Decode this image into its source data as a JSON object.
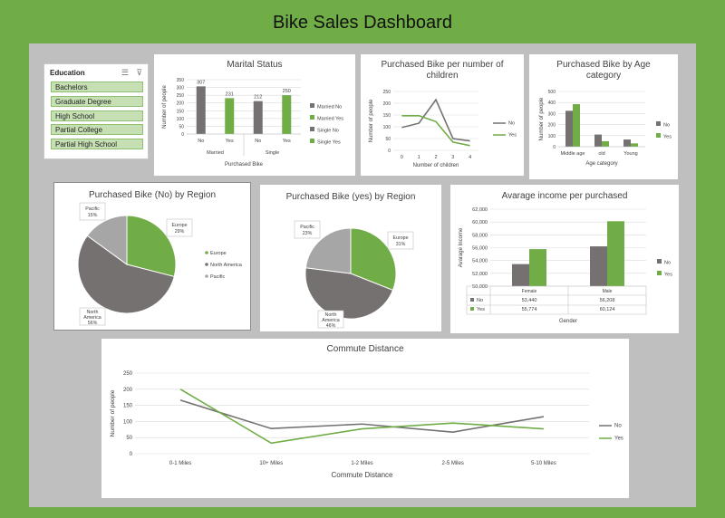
{
  "dashboard": {
    "title": "Bike Sales Dashboard"
  },
  "slicer": {
    "header": "Education",
    "items": [
      "Bachelors",
      "Graduate Degree",
      "High School",
      "Partial College",
      "Partial High School"
    ]
  },
  "colors": {
    "no": "#767171",
    "yes": "#70ad47",
    "pacific": "#a6a6a6",
    "frame": "#70ad47",
    "canvas": "#bfbfbf"
  },
  "chart_data": [
    {
      "id": "marital",
      "type": "bar",
      "title": "Marital Status",
      "xlabel": "Purchased Bike",
      "ylabel": "Number of people",
      "groups": [
        "Married",
        "Single"
      ],
      "subcategories": [
        "No",
        "Yes"
      ],
      "series": [
        {
          "name": "Married No",
          "group": "Married",
          "sub": "No",
          "value": 307,
          "color": "#767171"
        },
        {
          "name": "Married Yes",
          "group": "Married",
          "sub": "Yes",
          "value": 231,
          "color": "#70ad47"
        },
        {
          "name": "Single No",
          "group": "Single",
          "sub": "No",
          "value": 212,
          "color": "#767171"
        },
        {
          "name": "Single Yes",
          "group": "Single",
          "sub": "Yes",
          "value": 250,
          "color": "#70ad47"
        }
      ],
      "ylim": [
        0,
        350
      ],
      "yticks": [
        0,
        50,
        100,
        150,
        200,
        250,
        300,
        350
      ],
      "legend": "right"
    },
    {
      "id": "children",
      "type": "line",
      "title": "Purchased Bike per number of children",
      "xlabel": "Number of children",
      "ylabel": "Number of people",
      "x": [
        0,
        1,
        2,
        3,
        4
      ],
      "series": [
        {
          "name": "No",
          "values": [
            97,
            115,
            215,
            50,
            40
          ],
          "color": "#767171"
        },
        {
          "name": "Yes",
          "values": [
            147,
            147,
            122,
            35,
            20
          ],
          "color": "#70ad47"
        }
      ],
      "ylim": [
        0,
        250
      ],
      "yticks": [
        0,
        50,
        100,
        150,
        200,
        250
      ],
      "legend": "right"
    },
    {
      "id": "age",
      "type": "bar",
      "title": "Purchased Bike by Age category",
      "xlabel": "Age category",
      "ylabel": "Number of people",
      "categories": [
        "Middle age",
        "old",
        "Young"
      ],
      "series": [
        {
          "name": "No",
          "values": [
            325,
            110,
            65
          ],
          "color": "#767171"
        },
        {
          "name": "Yes",
          "values": [
            385,
            50,
            30
          ],
          "color": "#70ad47"
        }
      ],
      "ylim": [
        0,
        500
      ],
      "yticks": [
        0,
        100,
        200,
        300,
        400,
        500
      ],
      "legend": "right"
    },
    {
      "id": "region_no",
      "type": "pie",
      "title": "Purchased Bike (No) by Region",
      "slices": [
        {
          "label": "Europe",
          "pct": 29,
          "color": "#70ad47"
        },
        {
          "label": "North America",
          "pct": 56,
          "color": "#767171"
        },
        {
          "label": "Pacific",
          "pct": 15,
          "color": "#a6a6a6"
        }
      ],
      "legend": "right"
    },
    {
      "id": "region_yes",
      "type": "pie",
      "title": "Purchased Bike (yes) by Region",
      "slices": [
        {
          "label": "Europe",
          "pct": 31,
          "color": "#70ad47"
        },
        {
          "label": "North America",
          "pct": 46,
          "color": "#767171"
        },
        {
          "label": "Pacific",
          "pct": 23,
          "color": "#a6a6a6"
        }
      ]
    },
    {
      "id": "income",
      "type": "bar",
      "title": "Avarage income per purchased",
      "xlabel": "Gender",
      "ylabel": "Avarage Income",
      "categories": [
        "Female",
        "Male"
      ],
      "series": [
        {
          "name": "No",
          "values": [
            53440,
            56208
          ],
          "labels": [
            "53,440",
            "56,208"
          ],
          "color": "#767171"
        },
        {
          "name": "Yes",
          "values": [
            55774,
            60124
          ],
          "labels": [
            "55,774",
            "60,124"
          ],
          "color": "#70ad47"
        }
      ],
      "ylim": [
        50000,
        62000
      ],
      "yticks": [
        50000,
        52000,
        54000,
        56000,
        58000,
        60000,
        62000
      ],
      "yticklabels": [
        "50,000",
        "52,000",
        "54,000",
        "56,000",
        "58,000",
        "60,000",
        "62,000"
      ],
      "legend": "right"
    },
    {
      "id": "commute",
      "type": "line",
      "title": "Commute Distance",
      "xlabel": "Commute Distance",
      "ylabel": "Number of people",
      "categories": [
        "0-1 Miles",
        "10+ Miles",
        "1-2 Miles",
        "2-5 Miles",
        "5-10 Miles"
      ],
      "series": [
        {
          "name": "No",
          "values": [
            166,
            78,
            92,
            67,
            115
          ],
          "color": "#767171"
        },
        {
          "name": "Yes",
          "values": [
            200,
            33,
            77,
            95,
            77
          ],
          "color": "#70ad47"
        }
      ],
      "ylim": [
        0,
        250
      ],
      "yticks": [
        0,
        50,
        100,
        150,
        200,
        250
      ],
      "legend": "right"
    }
  ]
}
